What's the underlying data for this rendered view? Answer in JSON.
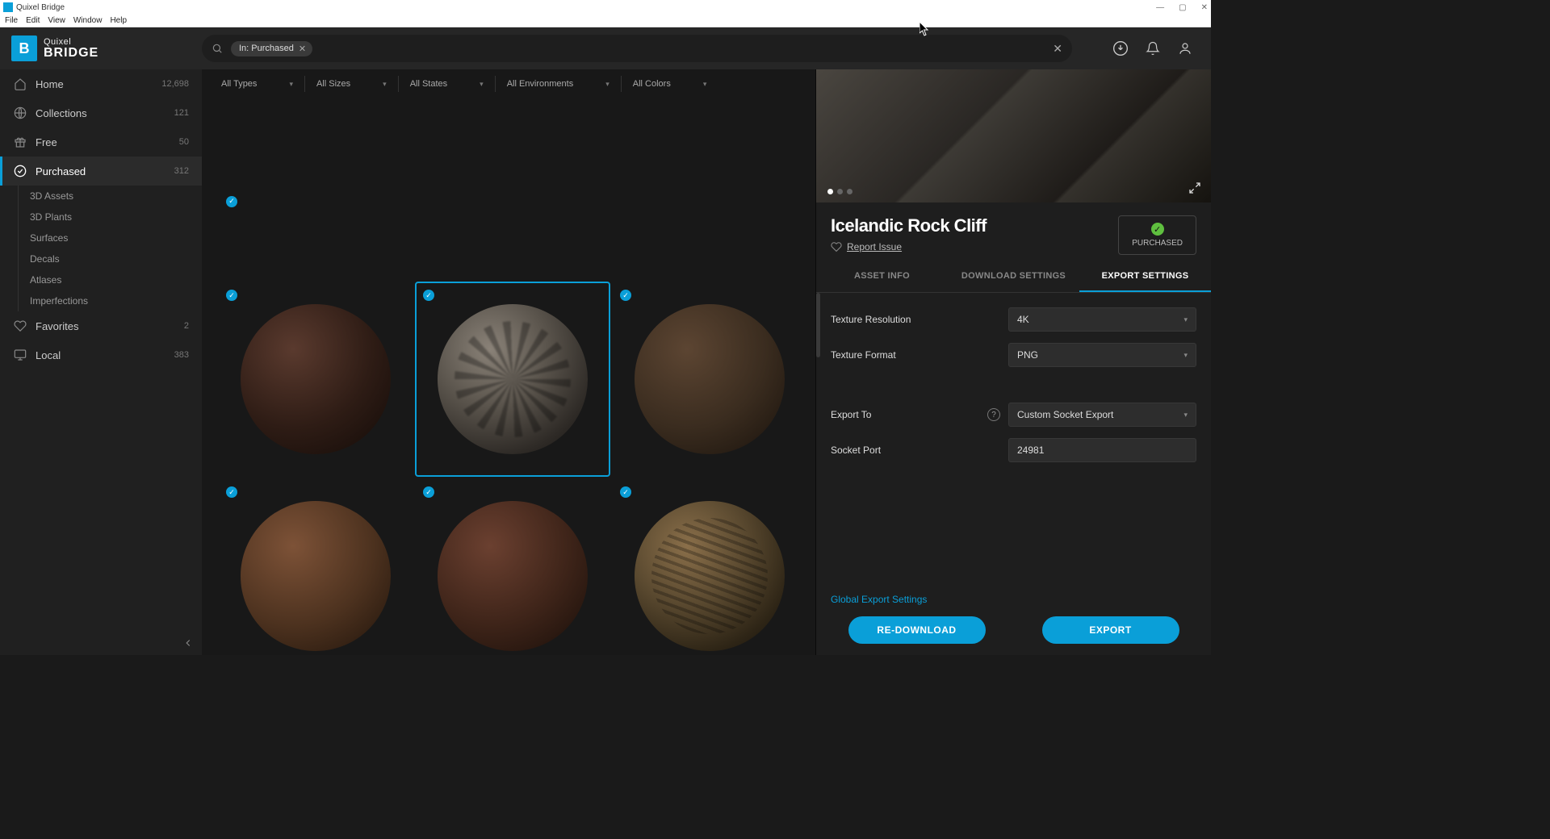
{
  "window": {
    "title": "Quixel Bridge"
  },
  "menubar": [
    "File",
    "Edit",
    "View",
    "Window",
    "Help"
  ],
  "logo": {
    "line1": "Quixel",
    "line2": "BRIDGE"
  },
  "search": {
    "chip": "In: Purchased"
  },
  "sidebar": {
    "items": [
      {
        "label": "Home",
        "count": "12,698"
      },
      {
        "label": "Collections",
        "count": "121"
      },
      {
        "label": "Free",
        "count": "50"
      },
      {
        "label": "Purchased",
        "count": "312"
      },
      {
        "label": "Favorites",
        "count": "2"
      },
      {
        "label": "Local",
        "count": "383"
      }
    ],
    "sub": [
      "3D Assets",
      "3D Plants",
      "Surfaces",
      "Decals",
      "Atlases",
      "Imperfections"
    ]
  },
  "filters": [
    "All Types",
    "All Sizes",
    "All States",
    "All Environments",
    "All Colors"
  ],
  "detail": {
    "title": "Icelandic Rock Cliff",
    "report": "Report Issue",
    "purchased": "PURCHASED",
    "tabs": [
      "ASSET INFO",
      "DOWNLOAD SETTINGS",
      "EXPORT SETTINGS"
    ],
    "settings": {
      "texture_resolution_label": "Texture Resolution",
      "texture_resolution_value": "4K",
      "texture_format_label": "Texture Format",
      "texture_format_value": "PNG",
      "export_to_label": "Export To",
      "export_to_value": "Custom Socket Export",
      "socket_port_label": "Socket Port",
      "socket_port_value": "24981"
    },
    "cutoff_link": "Global Export Settings",
    "actions": {
      "redownload": "RE-DOWNLOAD",
      "export": "EXPORT"
    }
  }
}
